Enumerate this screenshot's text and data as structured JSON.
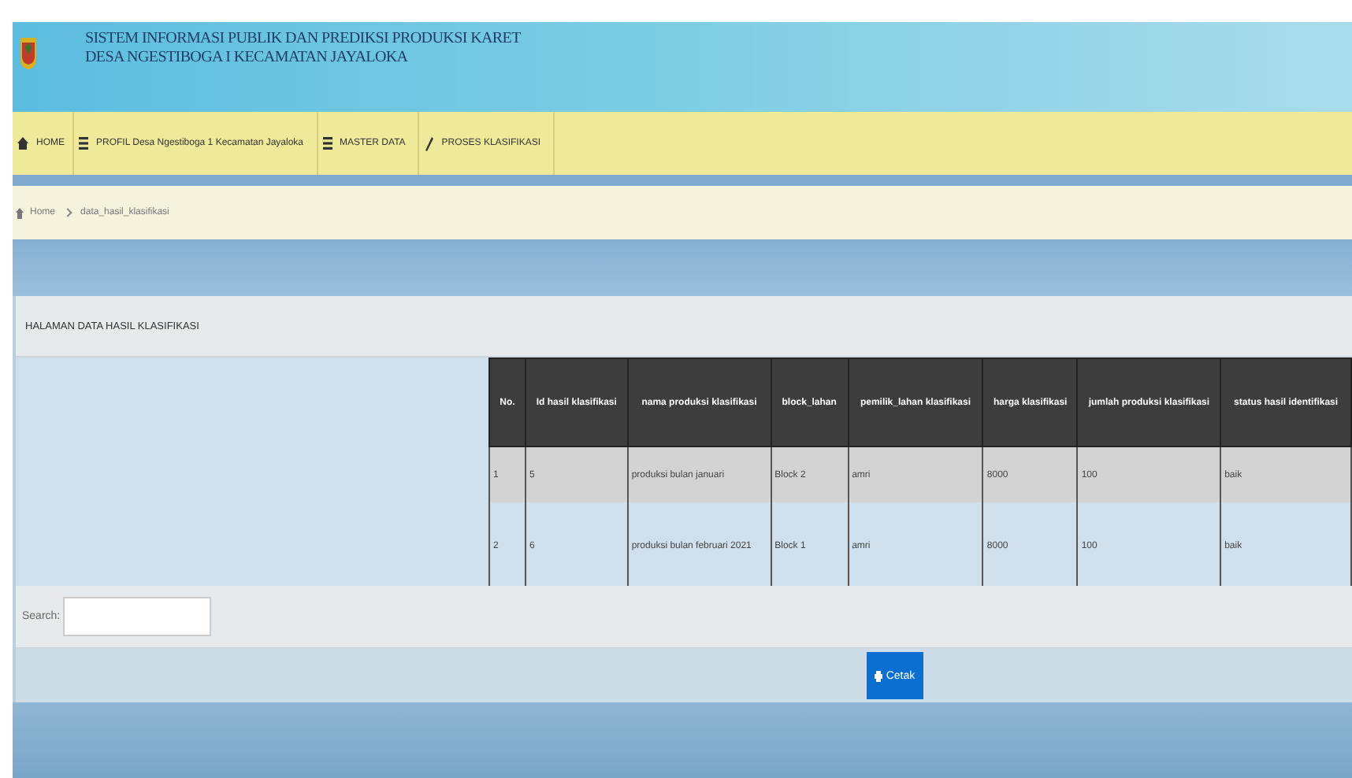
{
  "header": {
    "title_lines": [
      "SISTEM INFORMASI PUBLIK DAN PREDIKSI PRODUKSI KARET",
      "DESA NGESTIBOGA I KECAMATAN JAYALOKA"
    ]
  },
  "nav": [
    {
      "kind": "home",
      "label": "HOME"
    },
    {
      "kind": "list",
      "label": "PROFIL Desa Ngestiboga 1 Kecamatan Jayaloka"
    },
    {
      "kind": "list",
      "label": "MASTER DATA"
    },
    {
      "kind": "tool",
      "label": "PROSES KLASIFIKASI"
    }
  ],
  "breadcrumb": [
    "Home",
    "data_hasil_klasifikasi"
  ],
  "panel": {
    "title": "HALAMAN DATA HASIL KLASIFIKASI"
  },
  "table": {
    "columns": [
      "No.",
      "Id hasil klasifikasi",
      "nama produksi klasifikasi",
      "block_lahan",
      "pemilik_lahan klasifikasi",
      "harga klasifikasi",
      "jumlah produksi klasifikasi",
      "status hasil identifikasi"
    ],
    "rows": [
      [
        "1",
        "5",
        "produksi bulan januari",
        "Block 2",
        "amri",
        "8000",
        "100",
        "baik"
      ],
      [
        "2",
        "6",
        "produksi bulan februari 2021",
        "Block 1",
        "amri",
        "8000",
        "100",
        "baik"
      ]
    ]
  },
  "search": {
    "label": "Search:"
  },
  "print_button": {
    "label": "Cetak"
  }
}
